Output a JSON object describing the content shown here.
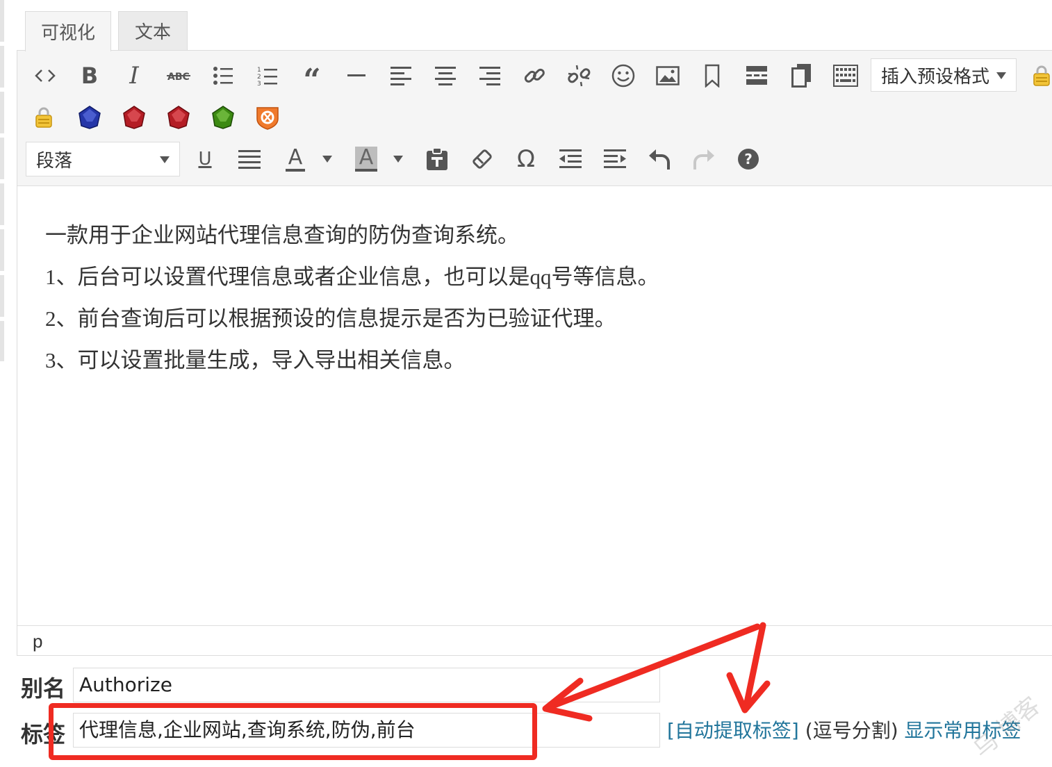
{
  "tabs": {
    "visual": "可视化",
    "text": "文本"
  },
  "toolbar": {
    "row1_icons": [
      "code-icon",
      "bold-icon",
      "italic-icon",
      "strikethrough-icon",
      "bullet-list-icon",
      "numbered-list-icon",
      "blockquote-icon",
      "horizontal-rule-icon",
      "align-left-icon",
      "align-center-icon",
      "align-right-icon",
      "link-icon",
      "unlink-icon",
      "emoji-icon",
      "image-icon",
      "bookmark-icon",
      "read-more-icon",
      "pagebreak-icon",
      "keyboard-icon"
    ],
    "insert_format_label": "插入预设格式",
    "row2_icons": [
      "lock-icon",
      "blue-gem-icon",
      "red-gem-icon",
      "red-gem-icon",
      "green-gem-icon",
      "shield-icon"
    ],
    "paragraph_select": "段落",
    "underline_glyph": "U",
    "text_color_glyph": "A",
    "bg_color_glyph": "A",
    "omega_glyph": "Ω",
    "help_glyph": "?"
  },
  "content": {
    "lines": [
      "一款用于企业网站代理信息查询的防伪查询系统。",
      "1、后台可以设置代理信息或者企业信息，也可以是qq号等信息。",
      "2、前台查询后可以根据预设的信息提示是否为已验证代理。",
      "3、可以设置批量生成，导入导出相关信息。"
    ]
  },
  "statusbar": {
    "path": "p"
  },
  "fields": {
    "alias_label": "别名",
    "alias_value": "Authorize",
    "tags_label": "标签",
    "tags_value": "代理信息,企业网站,查询系统,防伪,前台",
    "auto_extract": "[自动提取标签]",
    "comma_hint": "(逗号分割)",
    "show_common": "显示常用标签"
  },
  "colors": {
    "annotation": "#ef2b22",
    "link": "#21759b"
  }
}
